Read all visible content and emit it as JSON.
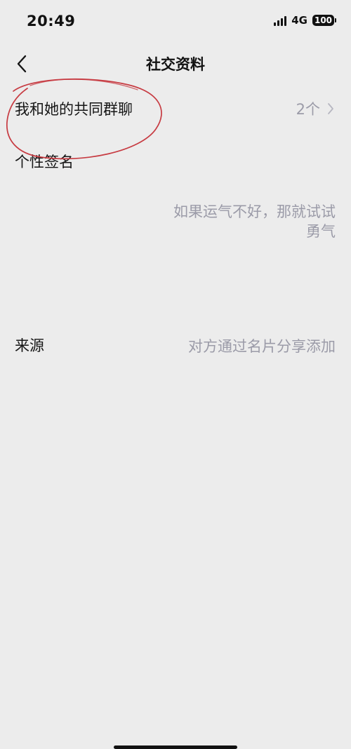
{
  "status_bar": {
    "time": "20:49",
    "network": "4G",
    "battery": "100"
  },
  "header": {
    "title": "社交资料",
    "back_icon": "chevron-left-icon"
  },
  "rows": {
    "groups": {
      "label": "我和她的共同群聊",
      "value": "2个",
      "chevron_icon": "chevron-right-icon"
    },
    "signature": {
      "label": "个性签名",
      "value": "如果运气不好，那就试试勇气"
    },
    "source": {
      "label": "来源",
      "value": "对方通过名片分享添加"
    }
  },
  "annotation": {
    "type": "red-hand-drawn-circle",
    "color": "#c73b42"
  },
  "colors": {
    "background": "#ececec",
    "text_primary": "#161616",
    "text_secondary": "#9b9ba8"
  }
}
